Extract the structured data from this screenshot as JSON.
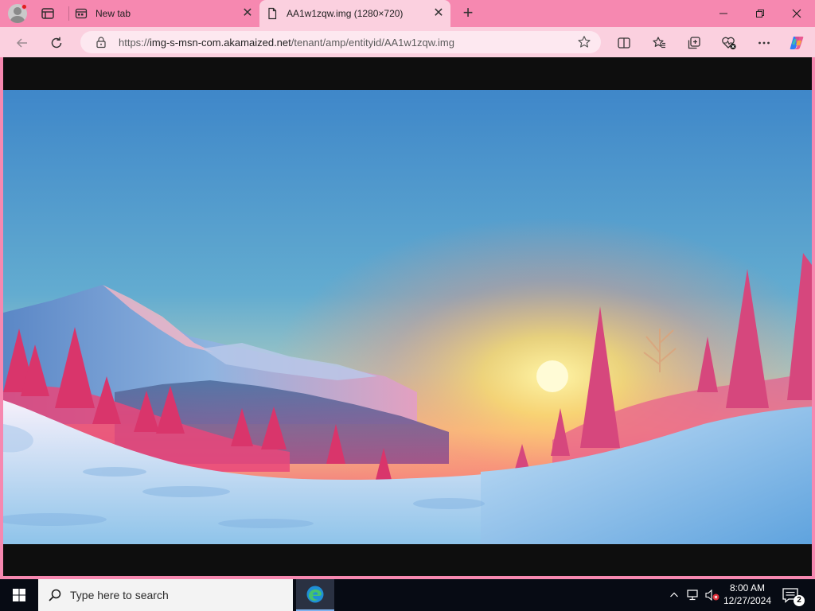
{
  "window": {
    "tabs": [
      {
        "title": "New tab",
        "icon": "new-tab-page-icon",
        "active": false
      },
      {
        "title": "AA1w1zqw.img (1280×720)",
        "icon": "document-icon",
        "active": true
      }
    ],
    "controls": [
      "minimize-icon",
      "restore-icon",
      "close-icon"
    ]
  },
  "toolbar": {
    "url_prefix": "https://",
    "url_host": "img-s-msn-com.akamaized.net",
    "url_path": "/tenant/amp/entityid/AA1w1zqw.img",
    "buttons": [
      "back-icon",
      "refresh-icon",
      "split-screen-icon",
      "favorites-icon",
      "collections-icon",
      "browser-essentials-icon",
      "more-icon",
      "copilot-icon"
    ]
  },
  "colors": {
    "chrome_accent": "#f688b0",
    "toolbar_bg": "#fbd0df",
    "taskbar_bg": "#070b14"
  },
  "taskbar": {
    "search_placeholder": "Type here to search",
    "time": "8:00 AM",
    "date": "12/27/2024",
    "notification_count": "2"
  }
}
